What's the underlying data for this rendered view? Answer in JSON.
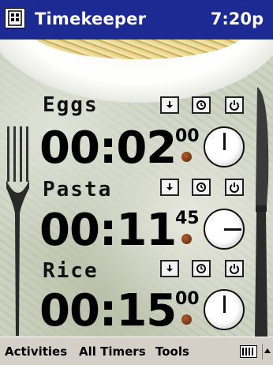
{
  "titlebar": {
    "app_title": "Timekeeper",
    "clock": "7:20p"
  },
  "timers": [
    {
      "name": "Eggs",
      "time": "00:02",
      "hundredths": "00",
      "dial_position": 0.0
    },
    {
      "name": "Pasta",
      "time": "00:11",
      "hundredths": "45",
      "dial_position": 0.25
    },
    {
      "name": "Rice",
      "time": "00:15",
      "hundredths": "00",
      "dial_position": 0.0
    }
  ],
  "timer_buttons": [
    "down-arrow-icon",
    "timer-icon",
    "power-icon"
  ],
  "menubar": {
    "items": [
      "Activities",
      "All Timers",
      "Tools"
    ]
  },
  "colors": {
    "title_bar": "#1e2a93",
    "menu_bar": "#d4d0c8",
    "led": "#7a3410"
  }
}
